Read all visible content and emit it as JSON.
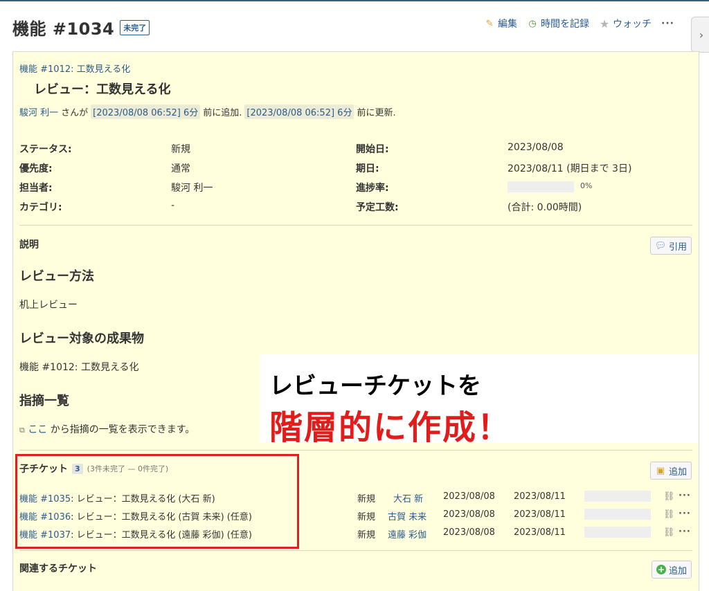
{
  "header": {
    "title": "機能 #1034",
    "status_badge": "未完了",
    "actions": {
      "edit": "編集",
      "log_time": "時間を記録",
      "watch": "ウォッチ",
      "more": "···"
    }
  },
  "issue": {
    "parent_link": "機能 #1012: 工数見える化",
    "subject": "レビュー：工数見える化",
    "author": {
      "name": "駿河 利一",
      "sep1": "さんが",
      "added_time": "[2023/08/08 06:52] 6分",
      "added_suffix": "前に追加.",
      "updated_time": "[2023/08/08 06:52] 6分",
      "updated_suffix": "前に更新."
    },
    "attributes": {
      "status_label": "ステータス:",
      "status": "新規",
      "priority_label": "優先度:",
      "priority": "通常",
      "assignee_label": "担当者:",
      "assignee": "駿河 利一",
      "category_label": "カテゴリ:",
      "category": "-",
      "start_label": "開始日:",
      "start": "2023/08/08",
      "due_label": "期日:",
      "due": "2023/08/11 (期日まで 3日)",
      "progress_label": "進捗率:",
      "progress": "0%",
      "progress_value": 0,
      "estimated_label": "予定工数:",
      "estimated": "(合計: 0.00時間)"
    },
    "description": {
      "label": "説明",
      "quote_button": "引用",
      "h1": "レビュー方法",
      "p1": "机上レビュー",
      "h2": "レビュー対象の成果物",
      "p2_link": "機能 #1012: 工数見える化",
      "h3": "指摘一覧",
      "p3_link": "ここ",
      "p3_text": "から指摘の一覧を表示できます。"
    },
    "subtasks": {
      "label": "子チケット",
      "count": "3",
      "note": "(3件未完了 — 0件完了)",
      "add_button": "追加",
      "rows": [
        {
          "issue": "機能 #1035",
          "subject": ": レビュー：工数見える化 (大石 新)",
          "status": "新規",
          "assignee": "大石 新",
          "start": "2023/08/08",
          "due": "2023/08/11",
          "progress": 0
        },
        {
          "issue": "機能 #1036",
          "subject": ": レビュー：工数見える化 (古賀 未来) (任意)",
          "status": "新規",
          "assignee": "古賀 未来",
          "start": "2023/08/08",
          "due": "2023/08/11",
          "progress": 0
        },
        {
          "issue": "機能 #1037",
          "subject": ": レビュー：工数見える化 (遠藤 彩伽) (任意)",
          "status": "新規",
          "assignee": "遠藤 彩伽",
          "start": "2023/08/08",
          "due": "2023/08/11",
          "progress": 0
        }
      ]
    },
    "relations": {
      "label": "関連するチケット",
      "add_button": "追加"
    }
  },
  "callout": {
    "line1": "レビューチケットを",
    "line2": "階層的に作成！"
  },
  "colors": {
    "issue_bg": "#ffffdd",
    "link": "#2a5b8c",
    "callout_red": "#e21b1b",
    "highlight_box": "#e02020"
  },
  "icons": {
    "edit": "pencil-icon",
    "log_time": "clock-icon",
    "watch": "star-icon",
    "quote": "speech-bubble-icon",
    "add_subtask": "add-subtask-icon",
    "add_relation": "plus-circle-icon",
    "unlink": "unlink-icon",
    "more": "more-icon",
    "sidebar": "chevron-right-icon"
  }
}
